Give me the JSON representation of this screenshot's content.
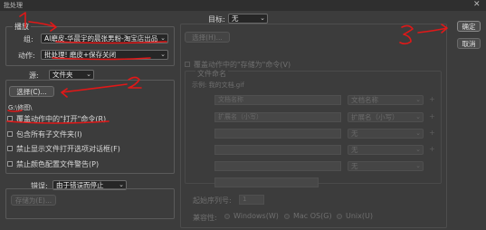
{
  "window": {
    "title": "批处理",
    "close_glyph": "✕"
  },
  "play_group": {
    "legend": "播放",
    "set_label": "组:",
    "set_value": "AI磨皮-华晨宇的晨张男粉-淘宝店出品",
    "action_label": "动作:",
    "action_value": "批处理! 磨皮+保存关闭"
  },
  "source": {
    "label": "源:",
    "value": "文件夹",
    "choose_button": "选择(C)...",
    "path": "G:\\修图\\",
    "options": [
      {
        "label": "覆盖动作中的\"打开\"命令(R)"
      },
      {
        "label": "包含所有子文件夹(I)"
      },
      {
        "label": "禁止显示文件打开选项对话框(F)"
      },
      {
        "label": "禁止颜色配置文件警告(P)"
      }
    ]
  },
  "errors": {
    "label": "错误:",
    "value": "由于错误而停止",
    "save_as_button": "存储为(E)..."
  },
  "destination": {
    "label": "目标:",
    "value": "无",
    "choose_button": "选择(H)...",
    "override_save_label": "覆盖动作中的\"存储为\"命令(V)",
    "file_naming_title": "文件命名",
    "example_label": "示例: 我的文档.gif",
    "naming_rows": [
      {
        "left": "文档名称",
        "right": "文档名称"
      },
      {
        "left": "扩展名（小写）",
        "right": "扩展名（小写）"
      },
      {
        "left": "",
        "right": "无"
      },
      {
        "left": "",
        "right": "无"
      },
      {
        "left": "",
        "right": "无"
      }
    ],
    "start_serial_label": "起始序列号:",
    "start_serial_value": "1",
    "compat_label": "兼容性:",
    "compat_options": [
      {
        "label": "Windows(W)"
      },
      {
        "label": "Mac OS(G)"
      },
      {
        "label": "Unix(U)"
      }
    ]
  },
  "actions": {
    "ok": "确定",
    "cancel": "取消"
  },
  "annotations": {
    "color": "#e01818",
    "marks": [
      "1",
      "2",
      "3"
    ]
  }
}
